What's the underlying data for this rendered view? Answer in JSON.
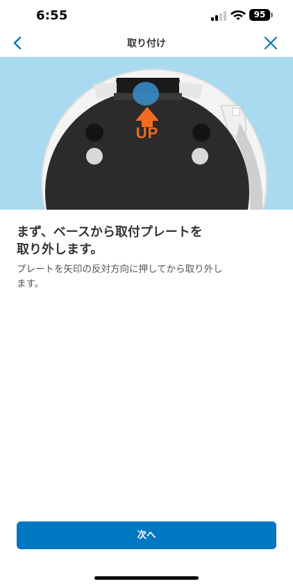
{
  "status_bar": {
    "time": "6:55",
    "battery_level": "95",
    "signal_icon": "cellular-signal-icon",
    "wifi_icon": "wifi-icon"
  },
  "nav": {
    "title": "取り付け",
    "back_icon": "chevron-left-icon",
    "close_icon": "close-icon",
    "accent_color": "#0077c2"
  },
  "illustration": {
    "arrow_label": "UP",
    "arrow_color": "#f26a21",
    "background_color": "#a9daf0"
  },
  "content": {
    "heading_lines": [
      "まず、ベースから取付プレートを",
      "取り外します。"
    ],
    "body_lines": [
      "プレートを矢印の反対方向に押してから取り外し",
      "ます。"
    ]
  },
  "footer": {
    "next_label": "次へ",
    "button_color": "#0077c2"
  }
}
